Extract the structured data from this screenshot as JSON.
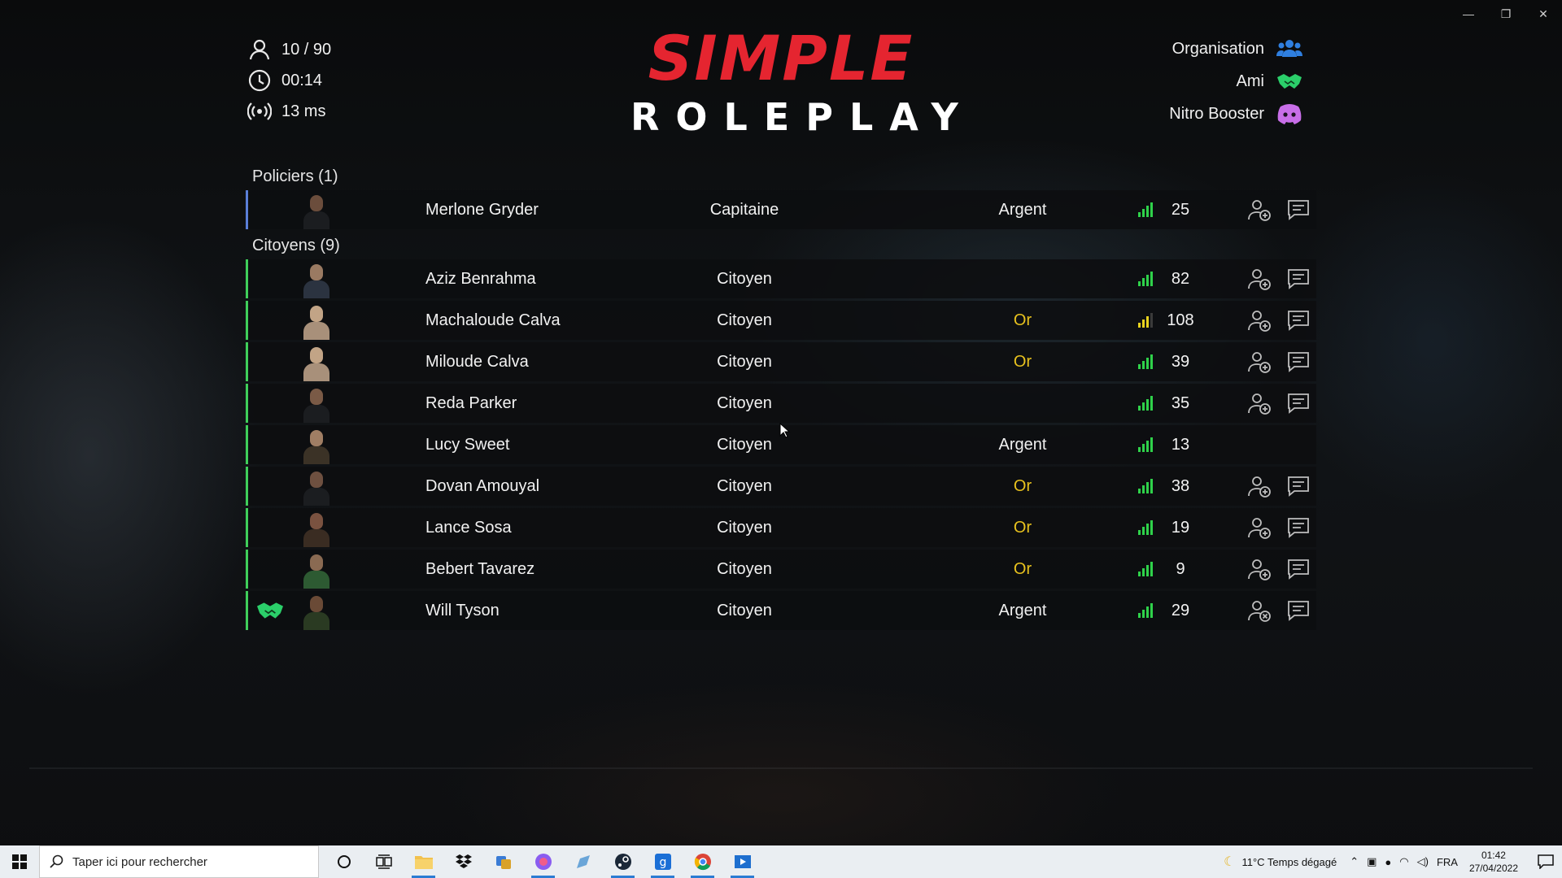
{
  "window": {
    "minimize": "—",
    "restore": "❐",
    "close": "✕"
  },
  "header": {
    "players": "10 / 90",
    "time": "00:14",
    "ping": "13 ms",
    "logo_top": "SIMPLE",
    "logo_bottom": "ROLEPLAY"
  },
  "legend": [
    {
      "label": "Organisation",
      "icon": "group-icon",
      "color": "#2f7fe0"
    },
    {
      "label": "Ami",
      "icon": "handshake-icon",
      "color": "#2bcf6a"
    },
    {
      "label": "Nitro Booster",
      "icon": "discord-icon",
      "color": "#c86ee8"
    }
  ],
  "sections": [
    {
      "title": "Policiers (1)",
      "rows": [
        {
          "name": "Merlone Gryder",
          "job": "Capitaine",
          "rank": "Argent",
          "ping": "25"
        }
      ]
    },
    {
      "title": "Citoyens (9)",
      "rows": [
        {
          "name": "Aziz Benrahma",
          "job": "Citoyen",
          "rank": "",
          "ping": "82"
        },
        {
          "name": "Machaloude Calva",
          "job": "Citoyen",
          "rank": "Or",
          "ping": "108"
        },
        {
          "name": "Miloude Calva",
          "job": "Citoyen",
          "rank": "Or",
          "ping": "39"
        },
        {
          "name": "Reda Parker",
          "job": "Citoyen",
          "rank": "",
          "ping": "35"
        },
        {
          "name": "Lucy Sweet",
          "job": "Citoyen",
          "rank": "Argent",
          "ping": "13"
        },
        {
          "name": "Dovan Amouyal",
          "job": "Citoyen",
          "rank": "Or",
          "ping": "38"
        },
        {
          "name": "Lance Sosa",
          "job": "Citoyen",
          "rank": "Or",
          "ping": "19"
        },
        {
          "name": "Bebert Tavarez",
          "job": "Citoyen",
          "rank": "Or",
          "ping": "9"
        },
        {
          "name": "Will Tyson",
          "job": "Citoyen",
          "rank": "Argent",
          "ping": "29"
        }
      ]
    }
  ],
  "colors": {
    "gold": "#e8c21e",
    "silver": "#f0f0f0",
    "police_bar": "#5a7fd8",
    "citizen_bar": "#3fcf5a",
    "signal_green": "#2fd14a",
    "signal_yellow": "#e8d21e",
    "logo_red": "#e52530"
  },
  "taskbar": {
    "search_placeholder": "Taper ici pour rechercher",
    "weather": "11°C  Temps dégagé",
    "lang": "FRA",
    "time": "01:42",
    "date": "27/04/2022"
  }
}
